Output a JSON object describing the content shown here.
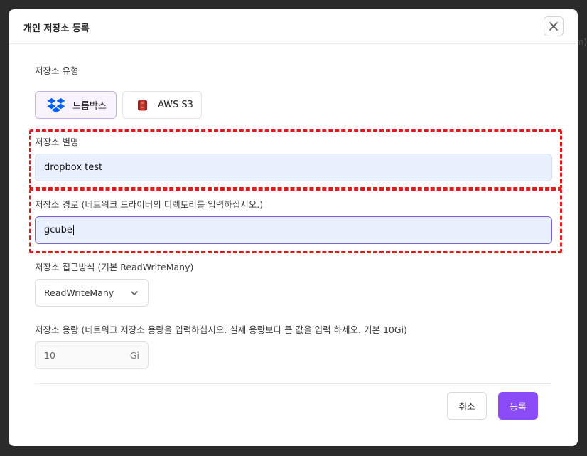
{
  "background": {
    "edge_text": "m)"
  },
  "modal": {
    "title": "개인 저장소 등록",
    "close_icon": "close-icon"
  },
  "storage_type": {
    "label": "저장소 유형",
    "options": [
      {
        "label": "드롭박스",
        "icon": "dropbox-icon",
        "selected": true
      },
      {
        "label": "AWS S3",
        "icon": "aws-s3-icon",
        "selected": false
      }
    ]
  },
  "alias": {
    "label": "저장소 별명",
    "value": "dropbox test"
  },
  "path": {
    "label": "저장소 경로 (네트워크 드라이버의 디렉토리를 입력하십시오.)",
    "value": "gcube"
  },
  "access_mode": {
    "label": "저장소 접근방식 (기본 ReadWriteMany)",
    "selected": "ReadWriteMany",
    "icon": "chevron-down-icon"
  },
  "capacity": {
    "label": "저장소 용량 (네트워크 저장소 용량을 입력하십시오. 실제 용량보다 큰 값을 입력 하세오. 기본 10Gi)",
    "placeholder": "10",
    "unit": "Gi"
  },
  "footer": {
    "cancel_label": "취소",
    "submit_label": "등록"
  },
  "colors": {
    "accent": "#8b4cf7",
    "input_bg": "#e9f0fe",
    "highlight": "#e01b1b",
    "dropbox": "#0061fe",
    "aws_s3": "#c7372f"
  }
}
